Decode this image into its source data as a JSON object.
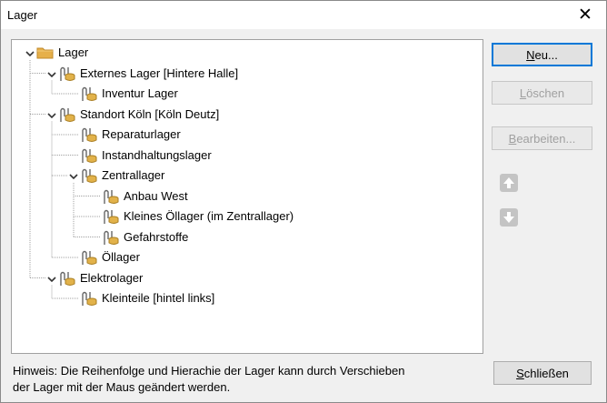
{
  "window": {
    "title": "Lager",
    "close_symbol": "✕"
  },
  "tree": [
    {
      "id": "lager",
      "label": "Lager",
      "level": 0,
      "expanded": true,
      "icon": "folder-icon"
    },
    {
      "id": "externes",
      "label": "Externes Lager [Hintere Halle]",
      "level": 1,
      "expanded": true,
      "icon": "storage-icon"
    },
    {
      "id": "inventur",
      "label": "Inventur Lager",
      "level": 2,
      "icon": "storage-icon"
    },
    {
      "id": "koeln",
      "label": "Standort Köln [Köln Deutz]",
      "level": 1,
      "expanded": true,
      "icon": "storage-icon"
    },
    {
      "id": "reparatur",
      "label": "Reparaturlager",
      "level": 2,
      "icon": "storage-icon"
    },
    {
      "id": "instand",
      "label": "Instandhaltungslager",
      "level": 2,
      "icon": "storage-icon"
    },
    {
      "id": "zentral",
      "label": "Zentrallager",
      "level": 2,
      "expanded": true,
      "icon": "storage-icon"
    },
    {
      "id": "anbau",
      "label": "Anbau West",
      "level": 3,
      "icon": "storage-icon"
    },
    {
      "id": "oellager-klein",
      "label": "Kleines Öllager (im Zentrallager)",
      "level": 3,
      "icon": "storage-icon"
    },
    {
      "id": "gefahr",
      "label": "Gefahrstoffe",
      "level": 3,
      "icon": "storage-icon"
    },
    {
      "id": "oellager",
      "label": "Öllager",
      "level": 2,
      "icon": "storage-icon"
    },
    {
      "id": "elektro",
      "label": "Elektrolager",
      "level": 1,
      "expanded": true,
      "icon": "storage-icon"
    },
    {
      "id": "kleinteile",
      "label": "Kleinteile [hintel links]",
      "level": 2,
      "icon": "storage-icon"
    }
  ],
  "buttons": {
    "neu": {
      "mnemonic": "N",
      "rest": "eu...",
      "enabled": true
    },
    "loeschen": {
      "mnemonic": "L",
      "rest": "öschen",
      "enabled": false
    },
    "bearbeiten": {
      "mnemonic": "B",
      "rest": "earbeiten...",
      "enabled": false
    },
    "schliessen": {
      "mnemonic": "S",
      "rest": "chließen",
      "enabled": true
    }
  },
  "move": {
    "up_icon": "arrow-up-icon",
    "down_icon": "arrow-down-icon",
    "enabled": false
  },
  "hint": {
    "line1": "Hinweis: Die Reihenfolge und Hierachie der Lager kann durch Verschieben",
    "line2": "der Lager mit der Maus geändert werden."
  },
  "colors": {
    "accent": "#0078d7",
    "folder": "#e6b04a",
    "storage": "#e2b24a",
    "disabled_text": "#a0a0a0"
  }
}
